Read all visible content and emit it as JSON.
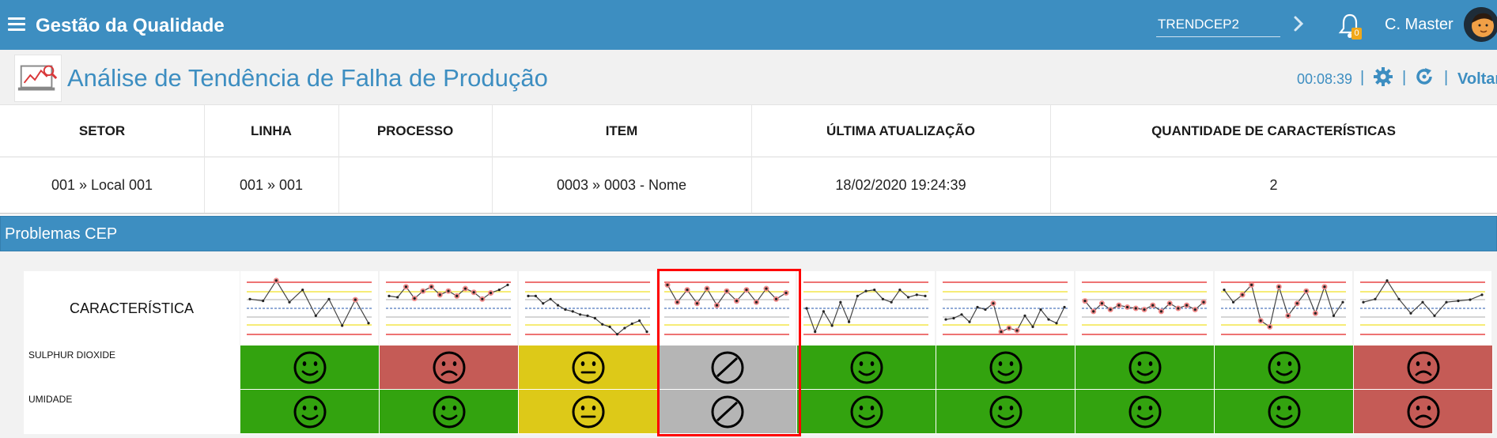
{
  "header": {
    "app_title": "Gestão da Qualidade",
    "module_code": "TRENDCEP2",
    "notification_count": "0",
    "user_name": "C. Master"
  },
  "title_bar": {
    "page_title": "Análise de Tendência de Falha de Produção",
    "timer": "00:08:39",
    "back_label": "Voltar"
  },
  "info_table": {
    "columns": [
      "SETOR",
      "LINHA",
      "PROCESSO",
      "ITEM",
      "ÚLTIMA ATUALIZAÇÃO",
      "QUANTIDADE DE CARACTERÍSTICAS"
    ],
    "values": [
      "001 » Local 001",
      "001 » 001",
      "",
      "0003 » 0003 - Nome",
      "18/02/2020 19:24:39",
      "2"
    ]
  },
  "section": {
    "title": "Problemas CEP"
  },
  "grid": {
    "header_label": "CARACTERÍSTICA",
    "chart_patterns": [
      "point-beyond-limits",
      "run-above-center",
      "upward-trend",
      "alternating-points",
      "points-near-center",
      "points-beyond-2-sigma",
      "stratification",
      "mixture",
      "point-beyond-limits-single"
    ],
    "rows": [
      {
        "label": "SULPHUR DIOXIDE",
        "statuses": [
          "ok",
          "bad",
          "warn",
          "na",
          "ok",
          "ok",
          "ok",
          "ok",
          "bad"
        ]
      },
      {
        "label": "UMIDADE",
        "statuses": [
          "ok",
          "ok",
          "warn",
          "na",
          "ok",
          "ok",
          "ok",
          "ok",
          "bad"
        ]
      }
    ],
    "highlighted_column": 4
  },
  "colors": {
    "primary": "#3d8ec1",
    "ok": "#33a30f",
    "bad": "#c55b56",
    "warn": "#ddc918",
    "na": "#b5b5b5",
    "highlight": "#ff0000"
  },
  "icons": {
    "ok": "smile-icon",
    "bad": "frown-icon",
    "warn": "neutral-face-icon",
    "na": "not-applicable-icon"
  }
}
